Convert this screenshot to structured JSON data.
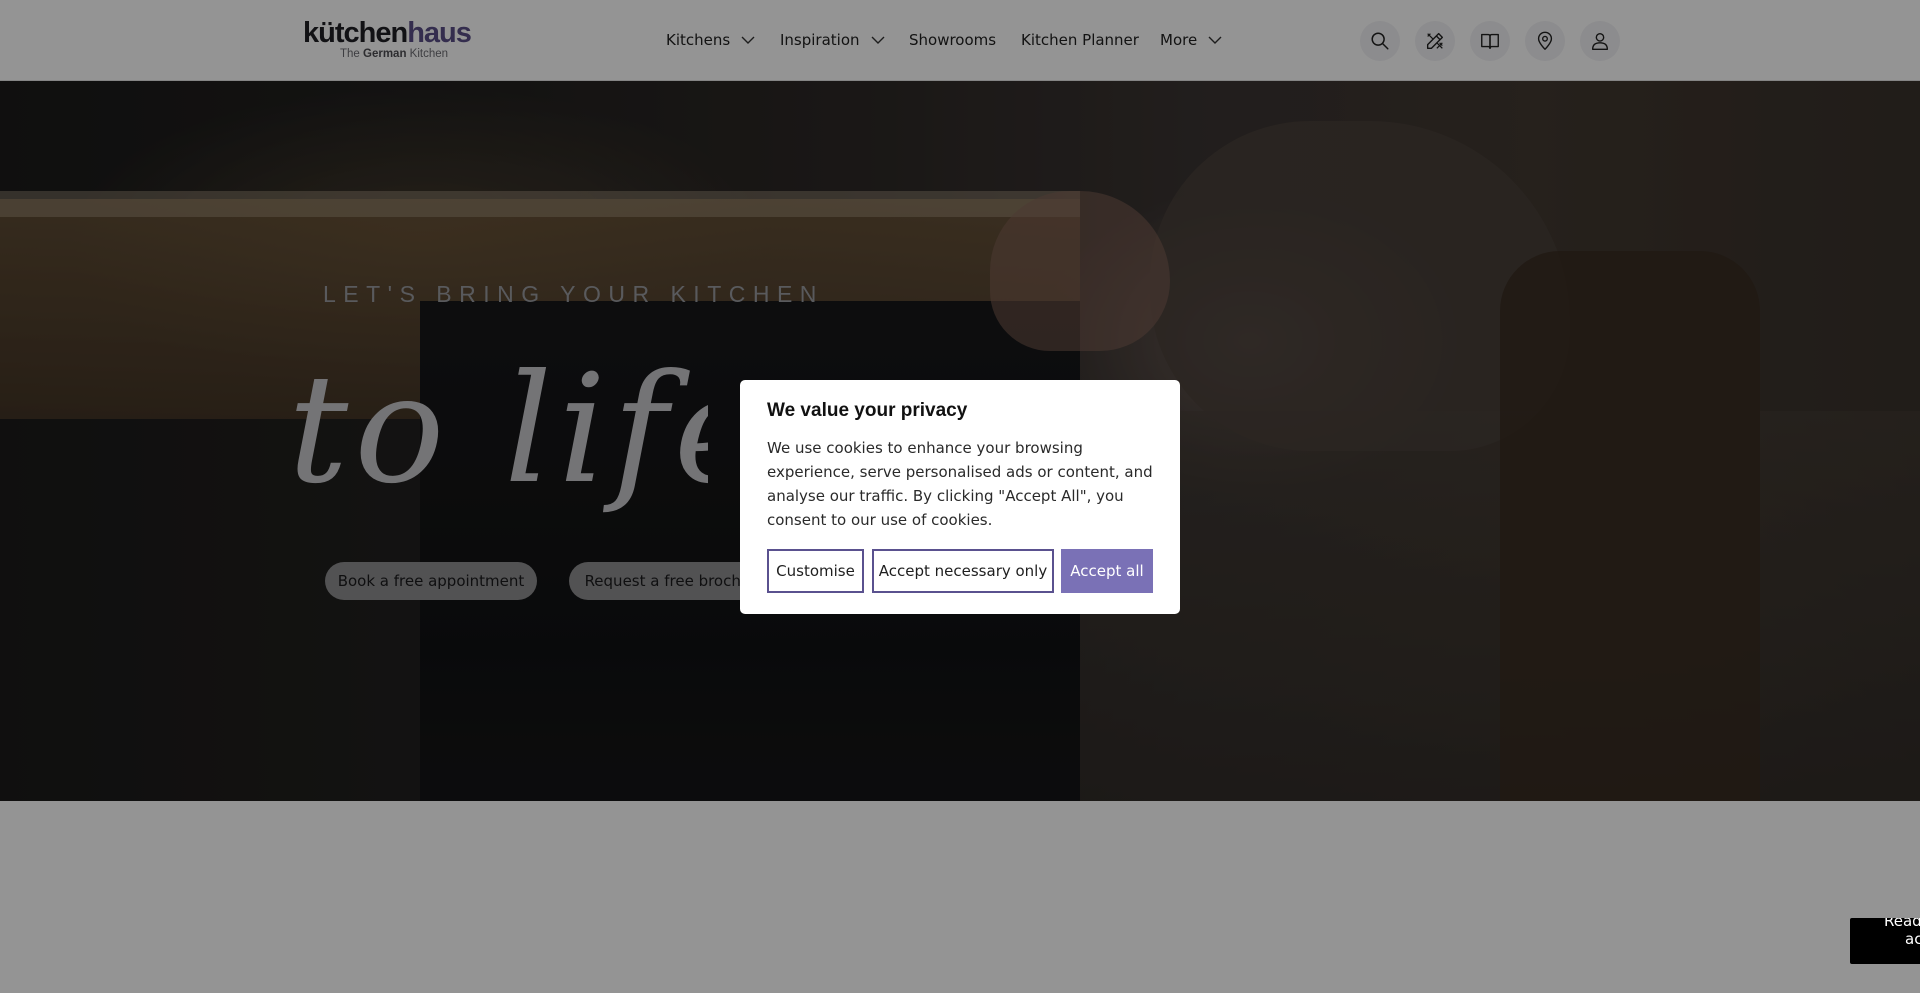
{
  "brand": {
    "logo_main_left": "kütchen",
    "logo_main_right": "haus",
    "tagline_pre": "The ",
    "tagline_bold": "German",
    "tagline_post": " Kitchen"
  },
  "nav": {
    "items": [
      {
        "label": "Kitchens",
        "has_dropdown": true
      },
      {
        "label": "Inspiration",
        "has_dropdown": true
      },
      {
        "label": "Showrooms",
        "has_dropdown": false
      },
      {
        "label": "Kitchen Planner",
        "has_dropdown": false
      },
      {
        "label": "More",
        "has_dropdown": true
      }
    ],
    "icons": [
      "search-icon",
      "design-tools-icon",
      "brochure-book-icon",
      "location-pin-icon",
      "account-icon"
    ]
  },
  "hero": {
    "eyebrow": "LET'S BRING YOUR KITCHEN",
    "script_text": "to life",
    "buttons": [
      {
        "label": "Book a free appointment"
      },
      {
        "label": "Request a free brochure"
      }
    ]
  },
  "cookie_banner": {
    "title": "We value your privacy",
    "body": "We use cookies to enhance your browsing experience, serve personalised ads or content, and analyse our traffic. By clicking \"Accept All\", you consent to our use of cookies.",
    "buttons": {
      "customise": "Customise",
      "necessary": "Accept necessary only",
      "accept_all": "Accept all"
    }
  },
  "side_widget": {
    "line1": "Read",
    "line2": "ac"
  },
  "colors": {
    "brand_purple": "#5a518f",
    "accept_button": "#7a71b6",
    "logo_haus": "#5a4f87"
  }
}
